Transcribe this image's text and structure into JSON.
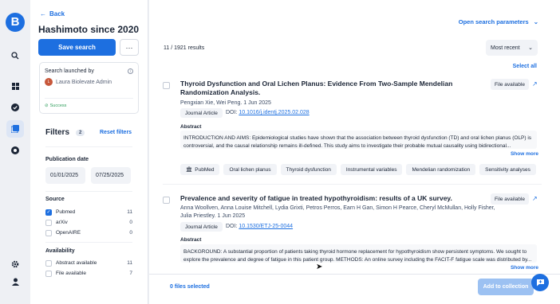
{
  "app": {
    "logo_letter": "B"
  },
  "rail": {
    "icons": [
      "search-icon",
      "dashboard-icon",
      "check-icon",
      "library-icon",
      "alert-icon",
      "settings-icon",
      "user-icon"
    ]
  },
  "left_panel": {
    "back_label": "Back",
    "title": "Hashimoto since 2020",
    "save_label": "Save search",
    "more_label": "···",
    "launched": {
      "label": "Search launched by",
      "user_initial": "L",
      "user_name": "Laura Biolevate Admin",
      "status": "Success"
    },
    "filters": {
      "title": "Filters",
      "count": "2",
      "reset_label": "Reset filters",
      "publication_date": {
        "label": "Publication date",
        "from": "01/01/2025",
        "to": "07/25/2025"
      },
      "source": {
        "label": "Source",
        "options": [
          {
            "label": "Pubmed",
            "count": "11",
            "checked": true
          },
          {
            "label": "arXiv",
            "count": "0",
            "checked": false
          },
          {
            "label": "OpenAIRE",
            "count": "0",
            "checked": false
          }
        ]
      },
      "availability": {
        "label": "Availability",
        "options": [
          {
            "label": "Abstract available",
            "count": "11",
            "checked": false
          },
          {
            "label": "File available",
            "count": "7",
            "checked": false
          }
        ]
      }
    }
  },
  "main": {
    "open_params_label": "Open search parameters",
    "results_count": "11 / 1921 results",
    "sort_label": "Most recent",
    "select_all_label": "Select all",
    "articles": [
      {
        "title": "Thyroid Dysfunction and Oral Lichen Planus: Evidence From Two-Sample Mendelian Randomization Analysis.",
        "file_label": "File available",
        "authors": "Pengxian Xie, Wei Peng. 1 Jun 2025",
        "journal_tag": "Journal Article",
        "doi_prefix": "DOI:",
        "doi": "10.1016/j.identj.2025.02.028",
        "abstract_label": "Abstract",
        "abstract": "INTRODUCTION AND AIMS: Epidemiological studies have shown that the association between thyroid dysfunction (TD) and oral lichen planus (OLP) is controversial, and the causal relationship remains ill-defined. This study aims to investigate their probable mutual causality using bidirectional...",
        "show_more": "Show more",
        "keywords": [
          "PubMed",
          "Oral lichen planus",
          "Thyroid dysfunction",
          "Instrumental variables",
          "Mendelian randomization",
          "Sensitivity analyses"
        ]
      },
      {
        "title": "Prevalence and severity of fatigue in treated hypothyroidism: results of a UK survey.",
        "file_label": "File available",
        "authors": "Anna Woollven, Anna Louise Mitchell, Lydia Grixti, Petros Perros, Earn H Gan, Simon H Pearce, Cheryl McMullan, Holly Fisher, Julia Priestley. 1 Jun 2025",
        "journal_tag": "Journal Article",
        "doi_prefix": "DOI:",
        "doi": "10.1530/ETJ-25-0044",
        "abstract_label": "Abstract",
        "abstract": "BACKGROUND: A substantial proportion of patients taking thyroid hormone replacement for hypothyroidism show persistent symptoms. We sought to explore the prevalence and degree of fatigue in this patient group. METHODS: An online survey including the FACIT-F fatigue scale was distributed by...",
        "show_more": "Show more"
      }
    ],
    "footer": {
      "files_selected": "0 files selected",
      "add_label": "Add to collection"
    }
  },
  "colors": {
    "accent": "#1d6fe0",
    "success": "#2e9d5b",
    "disabled_button": "#9cc1f2"
  }
}
